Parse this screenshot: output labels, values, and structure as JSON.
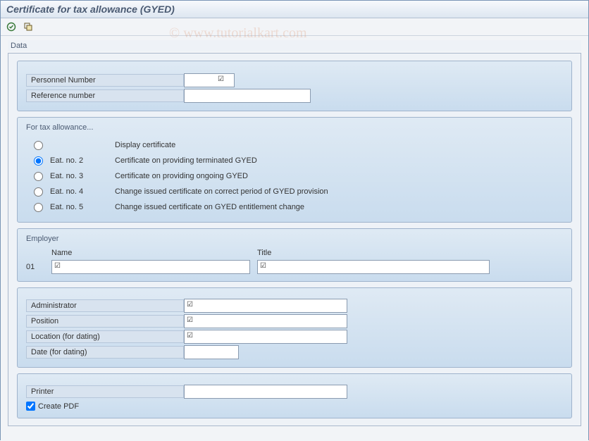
{
  "title": "Certificate for tax allowance (GYED)",
  "watermark": "© www.tutorialkart.com",
  "group": {
    "title": "Data"
  },
  "panel_data": {
    "personnel_label": "Personnel Number",
    "personnel_value": "",
    "reference_label": "Reference number",
    "reference_value": ""
  },
  "panel_tax": {
    "title": "For tax allowance...",
    "options": [
      {
        "code": "",
        "label": "Display certificate",
        "selected": false
      },
      {
        "code": "Eat. no. 2",
        "label": "Certificate on providing terminated GYED",
        "selected": true
      },
      {
        "code": "Eat. no. 3",
        "label": "Certificate on providing ongoing GYED",
        "selected": false
      },
      {
        "code": "Eat. no. 4",
        "label": "Change issued certificate on correct period of GYED provision",
        "selected": false
      },
      {
        "code": "Eat. no. 5",
        "label": "Change issued certificate on GYED entitlement change",
        "selected": false
      }
    ]
  },
  "panel_employer": {
    "title": "Employer",
    "name_header": "Name",
    "title_header": "Title",
    "row_num": "01",
    "name_value": "",
    "title_value": ""
  },
  "panel_admin": {
    "admin_label": "Administrator",
    "admin_value": "",
    "position_label": "Position",
    "position_value": "",
    "location_label": "Location (for dating)",
    "location_value": "",
    "date_label": "Date (for dating)",
    "date_value": ""
  },
  "panel_print": {
    "printer_label": "Printer",
    "printer_value": "",
    "create_pdf_label": "Create PDF",
    "create_pdf_checked": true
  }
}
